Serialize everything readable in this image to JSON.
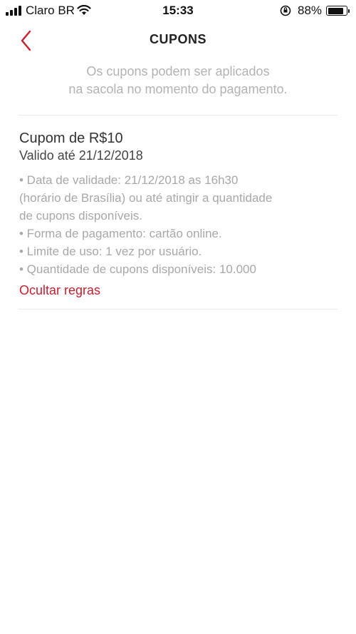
{
  "status_bar": {
    "carrier": "Claro BR",
    "time": "15:33",
    "battery": "88%",
    "battery_level": 0.88
  },
  "header": {
    "title": "CUPONS",
    "subtitle_line1": "Os cupons podem ser aplicados",
    "subtitle_line2": "na sacola no momento do pagamento."
  },
  "coupon": {
    "title": "Cupom de R$10",
    "validity": "Valido até 21/12/2018",
    "rules": [
      "• Data de validade: 21/12/2018 as 16h30",
      "(horário de Brasília) ou até atingir a quantidade",
      "de cupons disponíveis.",
      "• Forma de pagamento: cartão online.",
      "• Limite de uso: 1 vez por usuário.",
      "• Quantidade de cupons disponíveis: 10.000"
    ],
    "toggle_label": "Ocultar regras"
  },
  "colors": {
    "accent": "#c8202f",
    "muted_text": "#a8a8a8"
  }
}
